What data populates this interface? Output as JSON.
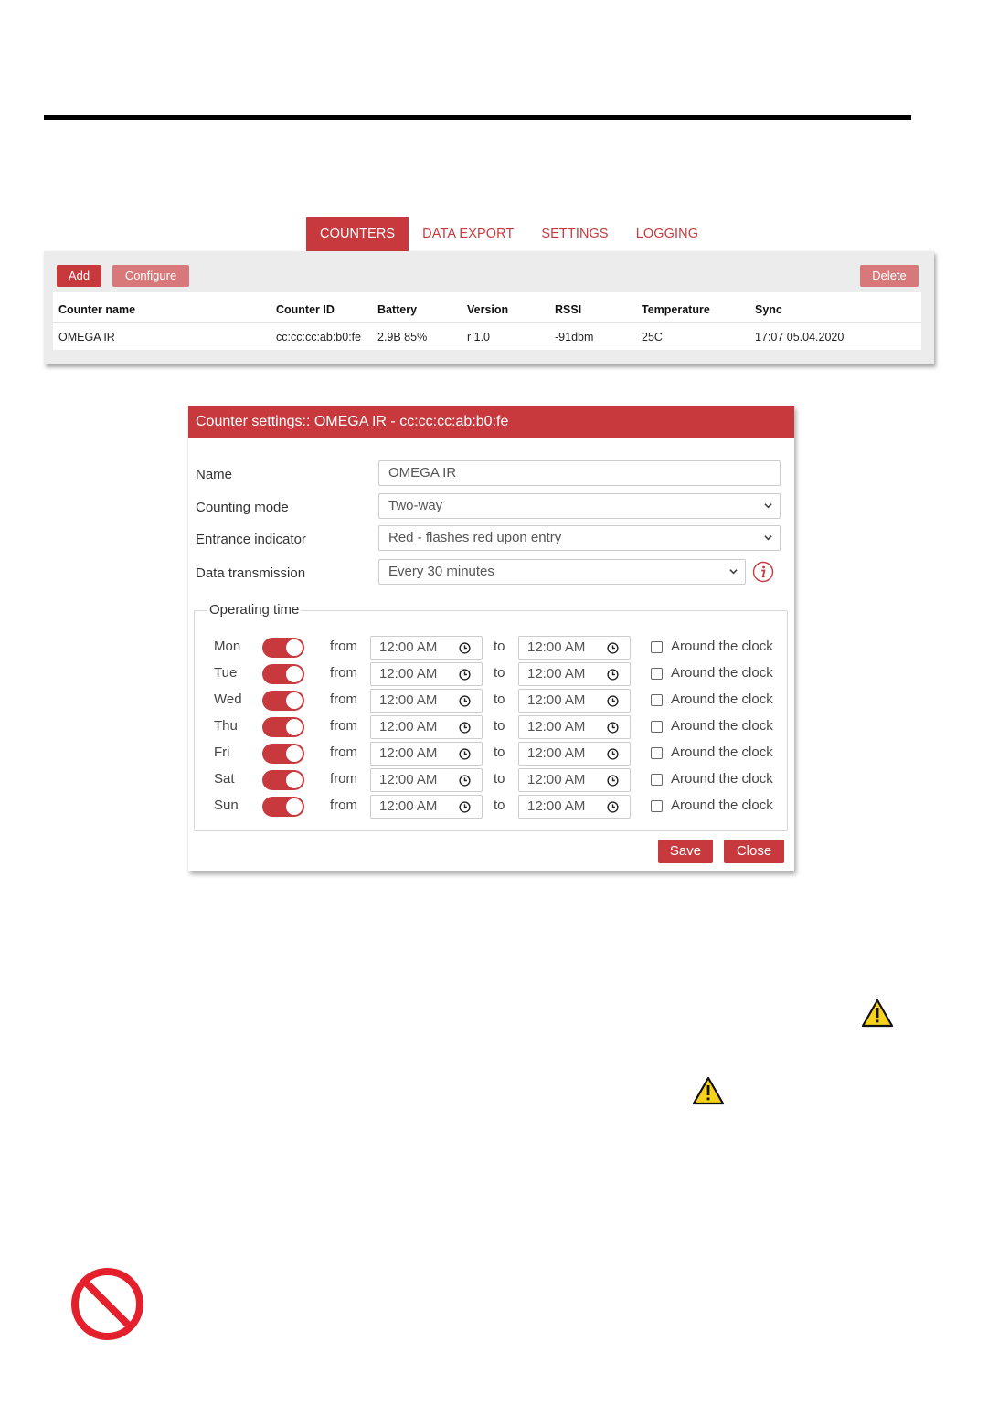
{
  "tabs": [
    {
      "label": "COUNTERS",
      "active": true
    },
    {
      "label": "DATA EXPORT",
      "active": false
    },
    {
      "label": "SETTINGS",
      "active": false
    },
    {
      "label": "LOGGING",
      "active": false
    }
  ],
  "toolbar": {
    "add_label": "Add",
    "configure_label": "Configure",
    "delete_label": "Delete"
  },
  "table": {
    "headers": [
      "Counter name",
      "Counter ID",
      "Battery",
      "Version",
      "RSSI",
      "Temperature",
      "Sync"
    ],
    "rows": [
      [
        "OMEGA IR",
        "cc:cc:cc:ab:b0:fe",
        "2.9B 85%",
        "r 1.0",
        "-91dbm",
        "25C",
        "17:07  05.04.2020"
      ]
    ]
  },
  "dialog": {
    "title": "Counter settings:: OMEGA IR - cc:cc:cc:ab:b0:fe",
    "name_label": "Name",
    "name_value": "OMEGA IR",
    "mode_label": "Counting mode",
    "mode_value": "Two-way",
    "indicator_label": "Entrance indicator",
    "indicator_value": "Red - flashes red upon entry",
    "transmission_label": "Data transmission",
    "transmission_value": "Every 30 minutes",
    "operating_time_label": "Operating time",
    "from_label": "from",
    "to_label": "to",
    "around_label": "Around the clock",
    "days": [
      {
        "day": "Mon",
        "enabled": true,
        "from": "12:00 AM",
        "to": "12:00 AM",
        "around": false
      },
      {
        "day": "Tue",
        "enabled": true,
        "from": "12:00 AM",
        "to": "12:00 AM",
        "around": false
      },
      {
        "day": "Wed",
        "enabled": true,
        "from": "12:00 AM",
        "to": "12:00 AM",
        "around": false
      },
      {
        "day": "Thu",
        "enabled": true,
        "from": "12:00 AM",
        "to": "12:00 AM",
        "around": false
      },
      {
        "day": "Fri",
        "enabled": true,
        "from": "12:00 AM",
        "to": "12:00 AM",
        "around": false
      },
      {
        "day": "Sat",
        "enabled": true,
        "from": "12:00 AM",
        "to": "12:00 AM",
        "around": false
      },
      {
        "day": "Sun",
        "enabled": true,
        "from": "12:00 AM",
        "to": "12:00 AM",
        "around": false
      }
    ],
    "save_label": "Save",
    "close_label": "Close"
  },
  "colors": {
    "accent": "#c8393e",
    "accent_light": "#d9787b",
    "panel_bg": "#ececec",
    "warning": "#f7d21c",
    "prohibited": "#e3202b"
  },
  "icons": [
    "chevron-down-icon",
    "info-icon",
    "clock-icon",
    "warning-icon",
    "prohibited-icon"
  ]
}
